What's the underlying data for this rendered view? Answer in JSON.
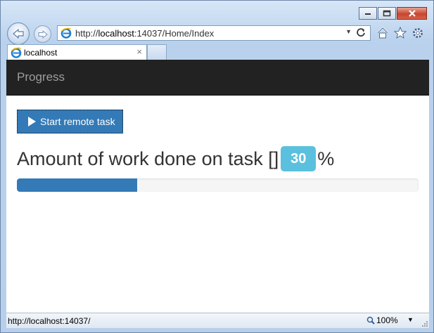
{
  "browser": {
    "address_url_prefix": "http://",
    "address_url_host": "localhost",
    "address_url_rest": ":14037/Home/Index",
    "tab_title": "localhost",
    "tab_close": "×"
  },
  "page": {
    "brand": "Progress",
    "start_button_label": "Start remote task",
    "heading_text": "Amount of work done on task []",
    "percent_value": "30",
    "percent_sign": "%",
    "progress_fraction": 0.3
  },
  "statusbar": {
    "url": "http://localhost:14037/",
    "zoom": "100%"
  },
  "colors": {
    "navbar": "#222222",
    "primary": "#337ab7",
    "badge": "#5bc0de"
  },
  "icons": [
    "back-icon",
    "forward-icon",
    "ie-logo-icon",
    "refresh-icon",
    "home-icon",
    "favorites-star-icon",
    "settings-gear-icon",
    "play-icon",
    "zoom-icon",
    "minimize-icon",
    "maximize-icon",
    "close-icon"
  ]
}
